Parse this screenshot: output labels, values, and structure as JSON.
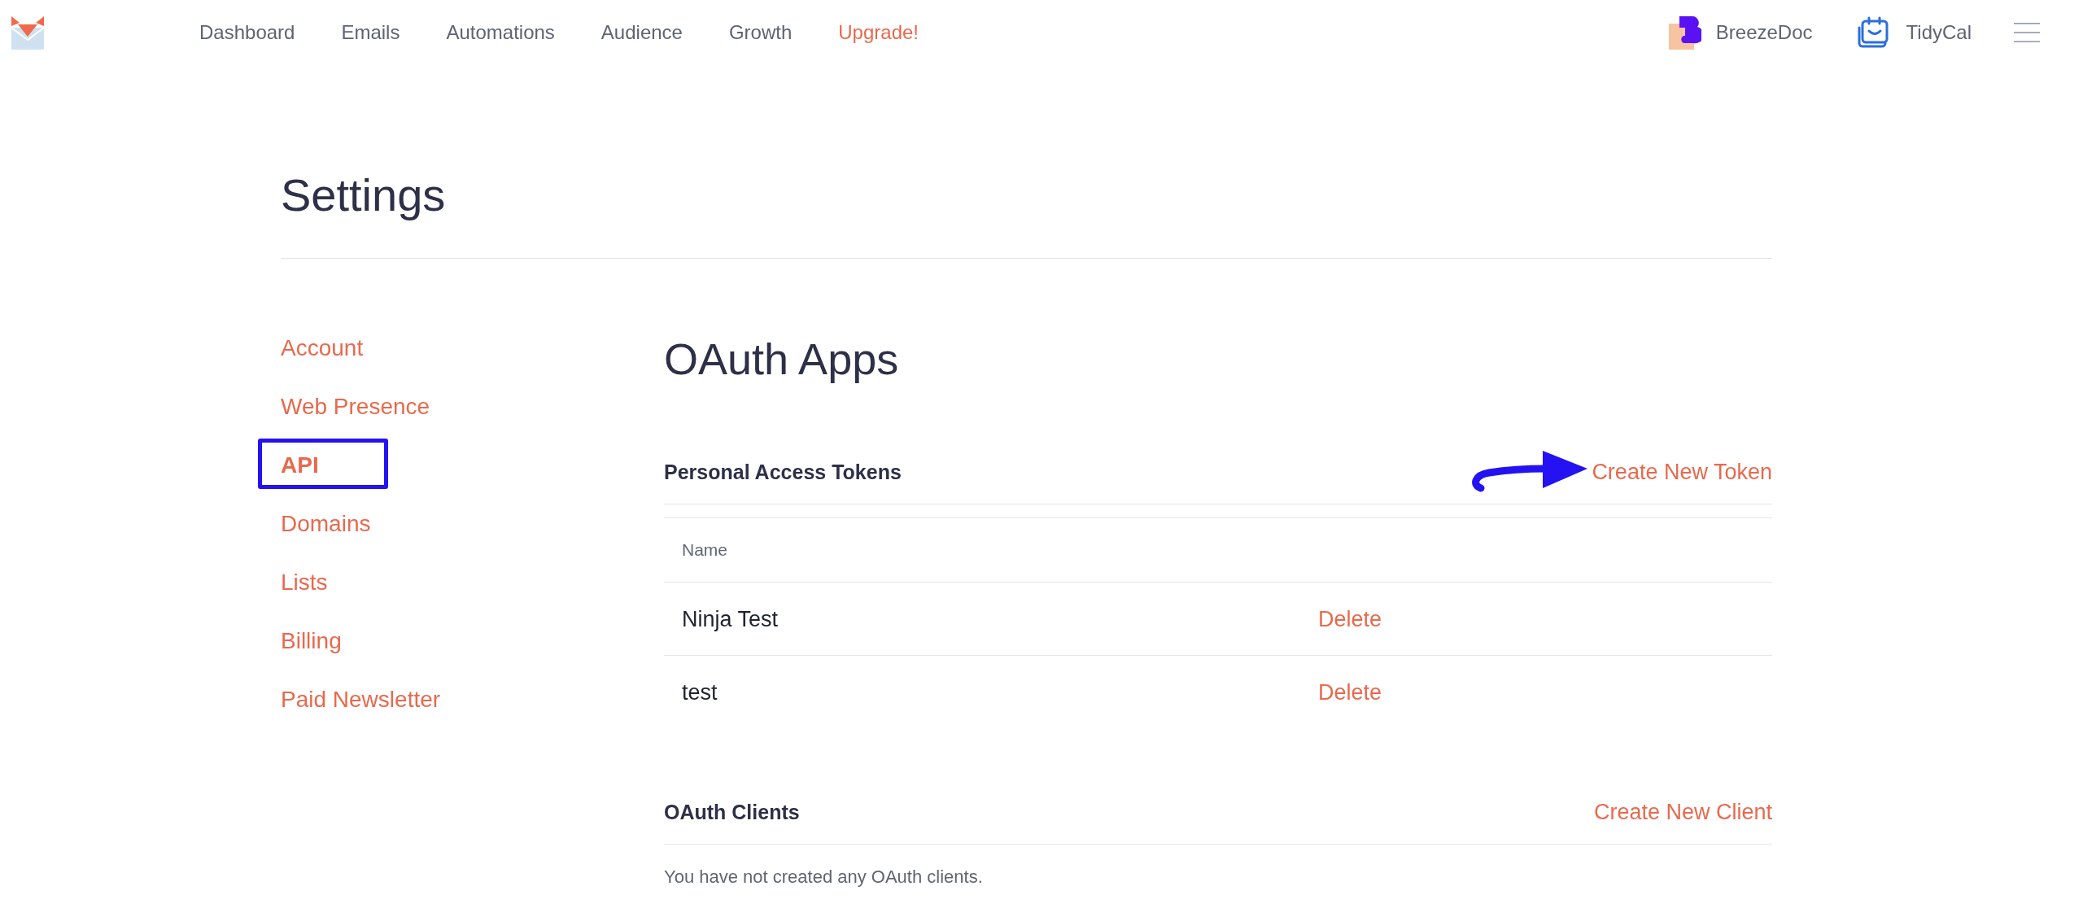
{
  "topbar": {
    "nav": [
      {
        "label": "Dashboard",
        "kind": "link"
      },
      {
        "label": "Emails",
        "kind": "link"
      },
      {
        "label": "Automations",
        "kind": "link"
      },
      {
        "label": "Audience",
        "kind": "link"
      },
      {
        "label": "Growth",
        "kind": "link"
      },
      {
        "label": "Upgrade!",
        "kind": "promo"
      }
    ],
    "apps": [
      {
        "label": "BreezeDoc",
        "kind": "breezedoc"
      },
      {
        "label": "TidyCal",
        "kind": "tidycal"
      }
    ]
  },
  "page": {
    "title": "Settings"
  },
  "sidebar": {
    "items": [
      {
        "label": "Account",
        "selected": false,
        "annotated": false
      },
      {
        "label": "Web Presence",
        "selected": false,
        "annotated": false
      },
      {
        "label": "API",
        "selected": true,
        "annotated": true
      },
      {
        "label": "Domains",
        "selected": false,
        "annotated": false
      },
      {
        "label": "Lists",
        "selected": false,
        "annotated": false
      },
      {
        "label": "Billing",
        "selected": false,
        "annotated": false
      },
      {
        "label": "Paid Newsletter",
        "selected": false,
        "annotated": false
      }
    ]
  },
  "content": {
    "title": "OAuth Apps",
    "sections": [
      {
        "title": "Personal Access Tokens",
        "action": {
          "label": "Create New Token",
          "annotated": true
        },
        "table": {
          "columns": [
            "Name"
          ],
          "rows": [
            {
              "name": "Ninja Test",
              "delete": "Delete"
            },
            {
              "name": "test",
              "delete": "Delete"
            }
          ]
        }
      },
      {
        "title": "OAuth Clients",
        "action": {
          "label": "Create New Client",
          "annotated": false
        },
        "empty_text": "You have not created any OAuth clients."
      }
    ]
  }
}
